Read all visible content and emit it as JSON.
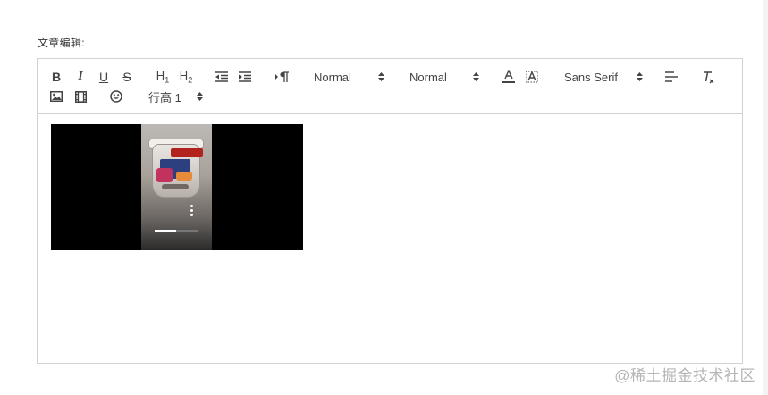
{
  "field": {
    "label": "文章编辑:"
  },
  "toolbar": {
    "row1": [
      {
        "name": "bold-button",
        "label": "B"
      },
      {
        "name": "italic-button",
        "label": "I"
      },
      {
        "name": "underline-button",
        "label": "U"
      },
      {
        "name": "strike-button",
        "label": "S"
      },
      {
        "name": "header-1-button",
        "label": "H1"
      },
      {
        "name": "header-2-button",
        "label": "H2"
      }
    ],
    "pickers": {
      "size": "Normal",
      "header": "Normal",
      "font": "Sans Serif",
      "line_height": "行高 1"
    },
    "icons": {
      "indent_decrease": "outdent-icon",
      "indent_increase": "indent-icon",
      "direction": "text-direction-icon",
      "color": "font-color-icon",
      "background": "background-color-icon",
      "align": "align-left-icon",
      "clean": "clear-format-icon",
      "image": "image-icon",
      "video": "video-icon",
      "emoji": "emoji-icon"
    }
  },
  "editor": {
    "video": {
      "progress_fraction": 0.48
    }
  },
  "watermark": {
    "text": "@稀土掘金技术社区"
  },
  "colors": {
    "border": "#d2d2d2",
    "icon": "#444444",
    "video_bg": "#000000",
    "watermark": "#b5b5b5"
  }
}
